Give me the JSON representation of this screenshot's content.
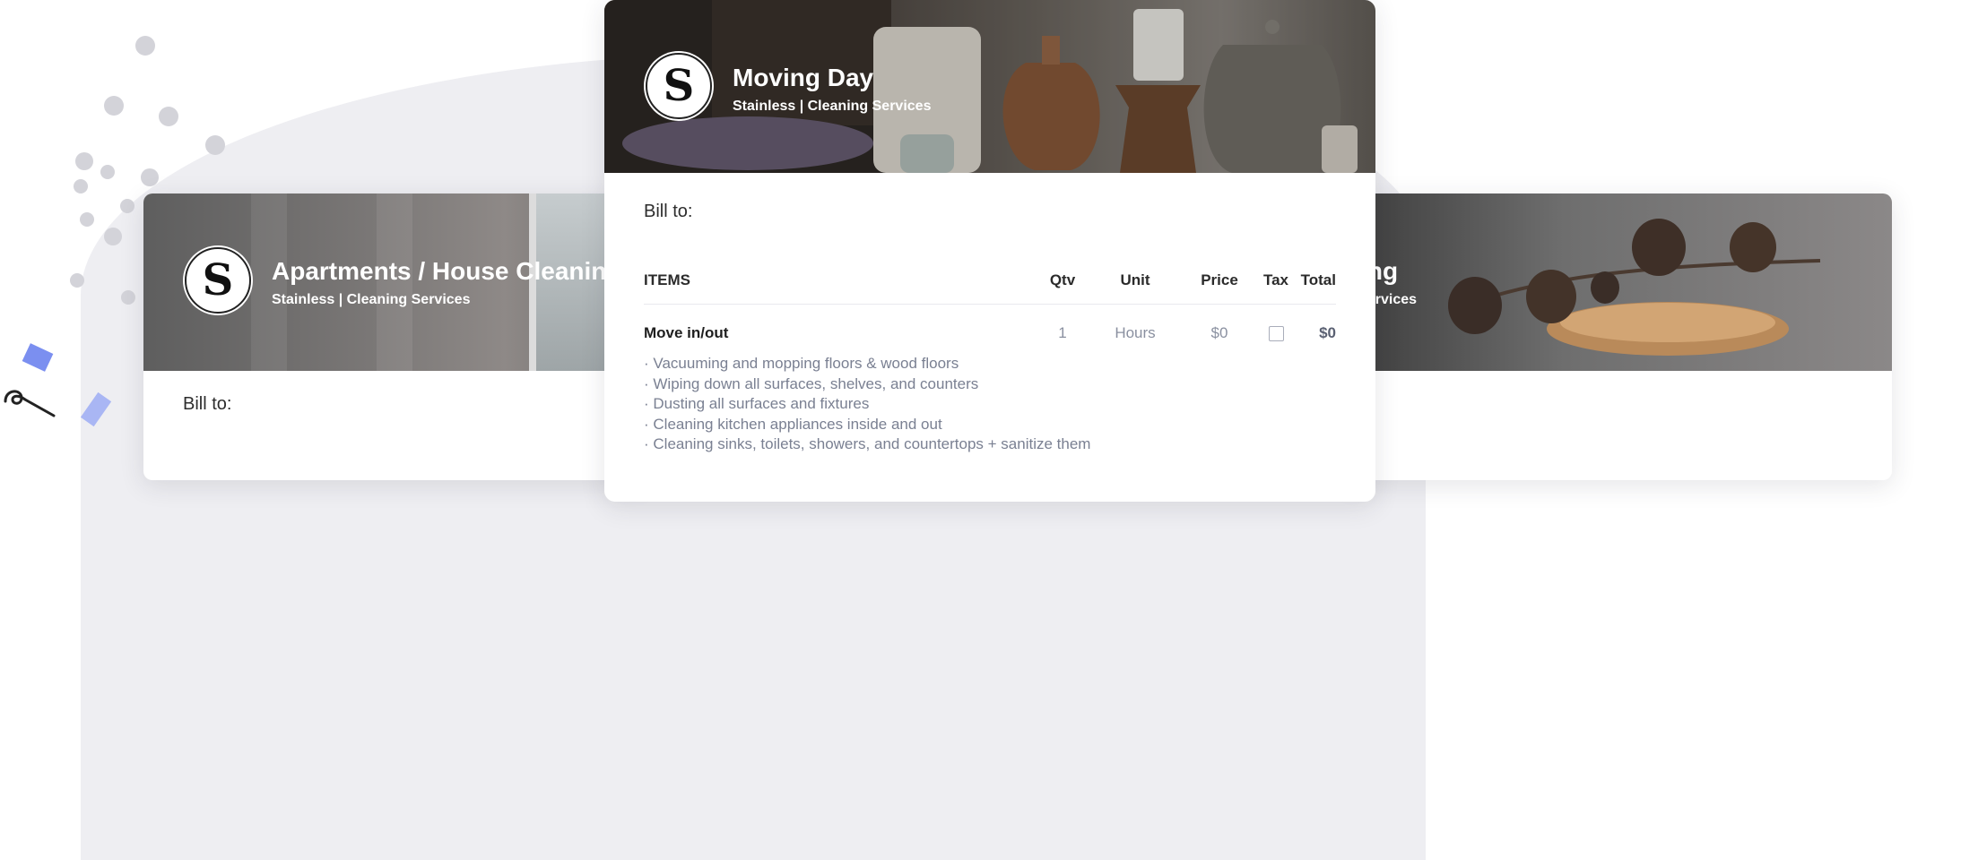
{
  "colors": {
    "accent_blue": "#7b8ff0",
    "light_blue": "#a9b6f4",
    "dot_gray": "#d3d3d9",
    "text_muted": "#7a8092"
  },
  "cards": {
    "left": {
      "title": "Apartments / House Cleaning",
      "subtitle": "Stainless | Cleaning Services",
      "bill_to": "Bill to:"
    },
    "right": {
      "title_partial": "ning",
      "subtitle_partial": "g Services"
    },
    "front": {
      "title": "Moving Day",
      "subtitle": "Stainless | Cleaning Services",
      "bill_to": "Bill to:",
      "table": {
        "headers": {
          "items": "ITEMS",
          "qty": "Qtv",
          "unit": "Unit",
          "price": "Price",
          "tax": "Tax",
          "total": "Total"
        },
        "rows": [
          {
            "item": "Move in/out",
            "qty": "1",
            "unit": "Hours",
            "price": "$0",
            "tax_checked": false,
            "total": "$0",
            "details": [
              "Vacuuming and mopping floors & wood floors",
              "Wiping down all surfaces, shelves, and counters",
              "Dusting all surfaces and fixtures",
              "Cleaning kitchen appliances inside and out",
              "Cleaning sinks, toilets, showers, and countertops + sanitize them"
            ]
          }
        ]
      }
    }
  },
  "logo": {
    "letter": "S",
    "icon": "stainless-logo-icon"
  }
}
